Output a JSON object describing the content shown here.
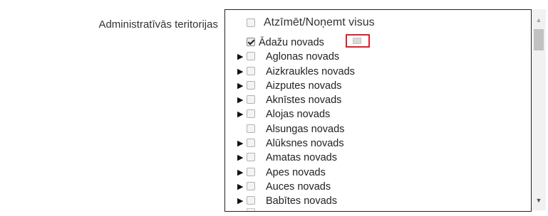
{
  "field": {
    "label": "Administratīvās teritorijas"
  },
  "check_all": {
    "label": "Atzīmēt/Noņemt visus",
    "checked": false
  },
  "items": [
    {
      "label": "Ādažu novads",
      "expandable": false,
      "checked": true
    },
    {
      "label": "Aglonas novads",
      "expandable": true,
      "checked": false
    },
    {
      "label": "Aizkraukles novads",
      "expandable": true,
      "checked": false
    },
    {
      "label": "Aizputes novads",
      "expandable": true,
      "checked": false
    },
    {
      "label": "Aknīstes novads",
      "expandable": true,
      "checked": false
    },
    {
      "label": "Alojas novads",
      "expandable": true,
      "checked": false
    },
    {
      "label": "Alsungas novads",
      "expandable": false,
      "checked": false
    },
    {
      "label": "Alūksnes novads",
      "expandable": true,
      "checked": false
    },
    {
      "label": "Amatas novads",
      "expandable": true,
      "checked": false
    },
    {
      "label": "Apes novads",
      "expandable": true,
      "checked": false
    },
    {
      "label": "Auces novads",
      "expandable": true,
      "checked": false
    },
    {
      "label": "Babītes novads",
      "expandable": true,
      "checked": false
    }
  ],
  "icons": {
    "expand": "▶",
    "scroll_up": "▲",
    "scroll_down": "▼"
  },
  "colors": {
    "highlight_border": "#e0202a",
    "listbox_border": "#222222"
  }
}
